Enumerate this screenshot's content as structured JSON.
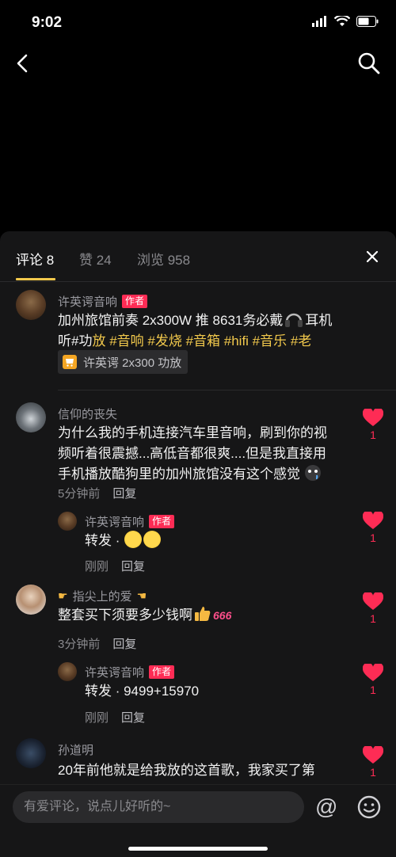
{
  "status_bar": {
    "time": "9:02"
  },
  "tabs": [
    {
      "label": "评论 8"
    },
    {
      "label": "赞 24"
    },
    {
      "label": "浏览 958"
    }
  ],
  "comments": [
    {
      "username": "许英谔音响",
      "badge": "作者",
      "text_plain_1": "加州旅馆前奏 2x300W 推 8631务必戴",
      "text_plain_2": "耳机",
      "line2_prefix": "听#功",
      "line2_tags": [
        "放",
        " #音",
        "响",
        " #发",
        "烧",
        " #音",
        "箱",
        " #hifi",
        " #音",
        "乐",
        " #老"
      ],
      "product": "许英谔 2x300 功放"
    },
    {
      "username": "信仰的丧失",
      "text_lines": [
        "为什么我的手机连接汽车里音响，刷到你的视",
        "频听着很震撼...高低音都很爽....但是我直接用",
        "手机播放酷狗里的加州旅馆没有这个感觉"
      ],
      "time": "5分钟前",
      "reply_label": "回复",
      "likes": "1",
      "reply": {
        "username": "许英谔音响",
        "badge": "作者",
        "text": "转发 · ",
        "time": "刚刚",
        "reply_label": "回复",
        "likes": "1"
      }
    },
    {
      "username": "指尖上的爱",
      "text": "整套买下须要多少钱啊",
      "text_suffix": "666",
      "time": "3分钟前",
      "reply_label": "回复",
      "likes": "1",
      "reply": {
        "username": "许英谔音响",
        "badge": "作者",
        "text": "转发 · 9499+15970",
        "time": "刚刚",
        "reply_label": "回复",
        "likes": "1"
      }
    },
    {
      "username": "孙道明",
      "text": "20年前他就是给我放的这首歌，我家买了第",
      "likes": "1"
    }
  ],
  "input": {
    "placeholder": "有爱评论，说点儿好听的~",
    "at_symbol": "@"
  },
  "colors": {
    "accent": "#f2c94c",
    "like": "#fe2c55",
    "sheet_bg": "#161617"
  }
}
